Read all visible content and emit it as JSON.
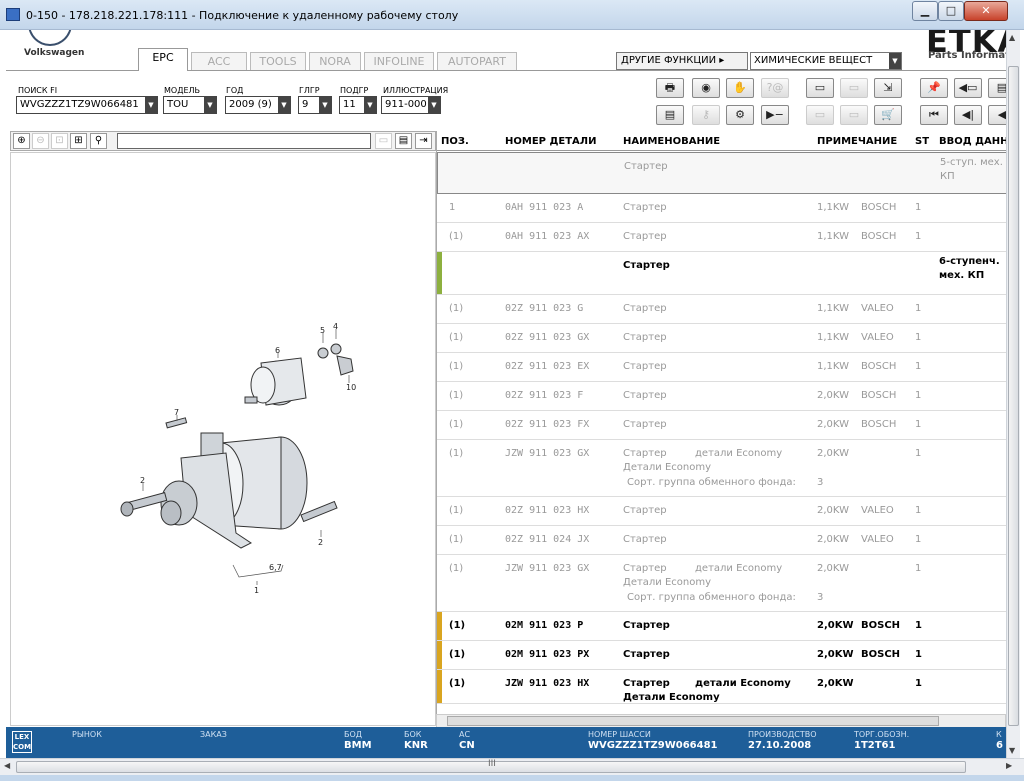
{
  "window": {
    "title": "0-150 - 178.218.221.178:111 - Подключение к удаленному рабочему столу",
    "min": "▁",
    "max": "□",
    "close": "✕"
  },
  "brand": {
    "vw": "Volkswagen",
    "etka": "ETKA",
    "etka_sub": "Parts Information"
  },
  "tabs": [
    {
      "label": "EPC",
      "active": true
    },
    {
      "label": "ACC"
    },
    {
      "label": "TOOLS"
    },
    {
      "label": "NORA"
    },
    {
      "label": "INFOLINE"
    },
    {
      "label": "AUTOPART"
    }
  ],
  "other_functions": "ДРУГИЕ ФУНКЦИИ ▸",
  "chem_select": "ХИМИЧЕСКИЕ ВЕЩЕСТ",
  "filters": [
    {
      "label": "ПОИСК FI",
      "value": "WVGZZZ1TZ9W066481"
    },
    {
      "label": "МОДЕЛЬ",
      "value": "TOU"
    },
    {
      "label": "ГОД",
      "value": "2009 (9)"
    },
    {
      "label": "ГЛГР",
      "value": "9"
    },
    {
      "label": "ПОДГР",
      "value": "11"
    },
    {
      "label": "ИЛЛЮСТРАЦИЯ",
      "value": "911-000"
    }
  ],
  "toolbar_top": [
    {
      "icon": "printer-icon",
      "g": "🖶"
    },
    {
      "icon": "cd-icon",
      "g": "◉"
    },
    {
      "icon": "handshake-icon",
      "g": "✋"
    },
    {
      "icon": "help-icon",
      "g": "?@",
      "dis": true
    },
    {
      "icon": "elsa-icon",
      "g": "▭"
    },
    {
      "icon": "gebrot-icon",
      "g": "▭",
      "dis": true
    },
    {
      "icon": "cart-arrow-icon",
      "g": "⇲"
    },
    {
      "icon": "pin-icon",
      "g": "📌"
    },
    {
      "icon": "back-book-icon",
      "g": "◀▭"
    },
    {
      "icon": "book-icon",
      "g": "▤"
    }
  ],
  "toolbar_bottom": [
    {
      "icon": "list-icon",
      "g": "▤"
    },
    {
      "icon": "key-icon",
      "g": "⚷",
      "dis": true
    },
    {
      "icon": "bike-icon",
      "g": "⚙"
    },
    {
      "icon": "play-minus-icon",
      "g": "▶−"
    },
    {
      "icon": "copy-icon",
      "g": "▭",
      "dis": true
    },
    {
      "icon": "document-icon",
      "g": "▭",
      "dis": true
    },
    {
      "icon": "cart-icon",
      "g": "🛒"
    },
    {
      "icon": "first-icon",
      "g": "⏮"
    },
    {
      "icon": "prev-icon",
      "g": "◀|"
    },
    {
      "icon": "next-icon",
      "g": "◀"
    }
  ],
  "table": {
    "headers": {
      "pos": "ПОЗ.",
      "part": "НОМЕР ДЕТАЛИ",
      "name": "НАИМЕНОВАНИЕ",
      "note": "ПРИМЕЧАНИЕ",
      "st": "ST",
      "input": "ВВОД ДАННЫХ"
    },
    "rows": [
      {
        "pos": "",
        "part": "",
        "name": "Стартер",
        "extra": "",
        "note": "",
        "maker": "",
        "st": "",
        "input": [
          "5-ступ. мех.",
          "КП"
        ],
        "style": "grey",
        "marker": "",
        "h": 42,
        "selected": true
      },
      {
        "pos": "1",
        "part": "0AH 911 023 A",
        "name": "Стартер",
        "extra": "",
        "note": "1,1KW",
        "maker": "BOSCH",
        "st": "1",
        "input": [],
        "style": "grey",
        "marker": "",
        "h": 29
      },
      {
        "pos": "(1)",
        "part": "0AH 911 023 AX",
        "name": "Стартер",
        "extra": "",
        "note": "1,1KW",
        "maker": "BOSCH",
        "st": "1",
        "input": [],
        "style": "grey",
        "marker": "",
        "h": 29
      },
      {
        "pos": "",
        "part": "",
        "name": "Стартер",
        "extra": "",
        "note": "",
        "maker": "",
        "st": "",
        "input": [
          "6-ступенч.",
          "мех. КП"
        ],
        "style": "bold",
        "marker": "#8db03f",
        "h": 43
      },
      {
        "pos": "(1)",
        "part": "02Z 911 023 G",
        "name": "Стартер",
        "extra": "",
        "note": "1,1KW",
        "maker": "VALEO",
        "st": "1",
        "input": [],
        "style": "grey",
        "marker": "",
        "h": 29
      },
      {
        "pos": "(1)",
        "part": "02Z 911 023 GX",
        "name": "Стартер",
        "extra": "",
        "note": "1,1KW",
        "maker": "VALEO",
        "st": "1",
        "input": [],
        "style": "grey",
        "marker": "",
        "h": 29
      },
      {
        "pos": "(1)",
        "part": "02Z 911 023 EX",
        "name": "Стартер",
        "extra": "",
        "note": "1,1KW",
        "maker": "BOSCH",
        "st": "1",
        "input": [],
        "style": "grey",
        "marker": "",
        "h": 29
      },
      {
        "pos": "(1)",
        "part": "02Z 911 023 F",
        "name": "Стартер",
        "extra": "",
        "note": "2,0KW",
        "maker": "BOSCH",
        "st": "1",
        "input": [],
        "style": "grey",
        "marker": "",
        "h": 29
      },
      {
        "pos": "(1)",
        "part": "02Z 911 023 FX",
        "name": "Стартер",
        "extra": "",
        "note": "2,0KW",
        "maker": "BOSCH",
        "st": "1",
        "input": [],
        "style": "grey",
        "marker": "",
        "h": 29
      },
      {
        "pos": "(1)",
        "part": "JZW 911 023 GX",
        "name": "Стартер",
        "extra": "детали Economy",
        "line2": "Детали Economy",
        "line3": "Сорт. группа обменного фонда:",
        "line3val": "3",
        "note": "2,0KW",
        "maker": "",
        "st": "1",
        "input": [],
        "style": "grey",
        "marker": "",
        "h": 57
      },
      {
        "pos": "(1)",
        "part": "02Z 911 023 HX",
        "name": "Стартер",
        "extra": "",
        "note": "2,0KW",
        "maker": "VALEO",
        "st": "1",
        "input": [],
        "style": "grey",
        "marker": "",
        "h": 29
      },
      {
        "pos": "(1)",
        "part": "02Z 911 024 JX",
        "name": "Стартер",
        "extra": "",
        "note": "2,0KW",
        "maker": "VALEO",
        "st": "1",
        "input": [],
        "style": "grey",
        "marker": "",
        "h": 29
      },
      {
        "pos": "(1)",
        "part": "JZW 911 023 GX",
        "name": "Стартер",
        "extra": "детали Economy",
        "line2": "Детали Economy",
        "line3": "Сорт. группа обменного фонда:",
        "line3val": "3",
        "note": "2,0KW",
        "maker": "",
        "st": "1",
        "input": [],
        "style": "grey",
        "marker": "",
        "h": 57
      },
      {
        "pos": "(1)",
        "part": "02M 911 023 P",
        "name": "Стартер",
        "extra": "",
        "note": "2,0KW",
        "maker": "BOSCH",
        "st": "1",
        "input": [],
        "style": "bold",
        "marker": "#d9a520",
        "h": 29
      },
      {
        "pos": "(1)",
        "part": "02M 911 023 PX",
        "name": "Стартер",
        "extra": "",
        "note": "2,0KW",
        "maker": "BOSCH",
        "st": "1",
        "input": [],
        "style": "bold",
        "marker": "#d9a520",
        "h": 29
      },
      {
        "pos": "(1)",
        "part": "JZW 911 023 HX",
        "name": "Стартер",
        "extra": "детали Economy",
        "line2": "Детали Economy",
        "note": "2,0KW",
        "maker": "",
        "st": "1",
        "input": [],
        "style": "bold",
        "marker": "#d9a520",
        "h": 34
      }
    ]
  },
  "illustration": {
    "labels": [
      "6",
      "5",
      "4",
      "10",
      "7",
      "2",
      "2",
      "6,7",
      "1"
    ]
  },
  "status": {
    "lexcom": "LEX COM",
    "market": {
      "label": "РЫНОК",
      "value": ""
    },
    "order": {
      "label": "ЗАКАЗ",
      "value": ""
    },
    "bod": {
      "label": "БОД",
      "value": "BMM"
    },
    "bok": {
      "label": "БОК",
      "value": "KNR"
    },
    "ac": {
      "label": "АС",
      "value": "CN"
    },
    "chassis": {
      "label": "НОМЕР ШАССИ",
      "value": "WVGZZZ1TZ9W066481"
    },
    "production": {
      "label": "ПРОИЗВОДСТВО",
      "value": "27.10.2008"
    },
    "trade": {
      "label": "ТОРГ.ОБОЗН.",
      "value": "1T2T61"
    },
    "k": {
      "label": "К",
      "value": "6"
    }
  },
  "hscroll_grip": "III"
}
